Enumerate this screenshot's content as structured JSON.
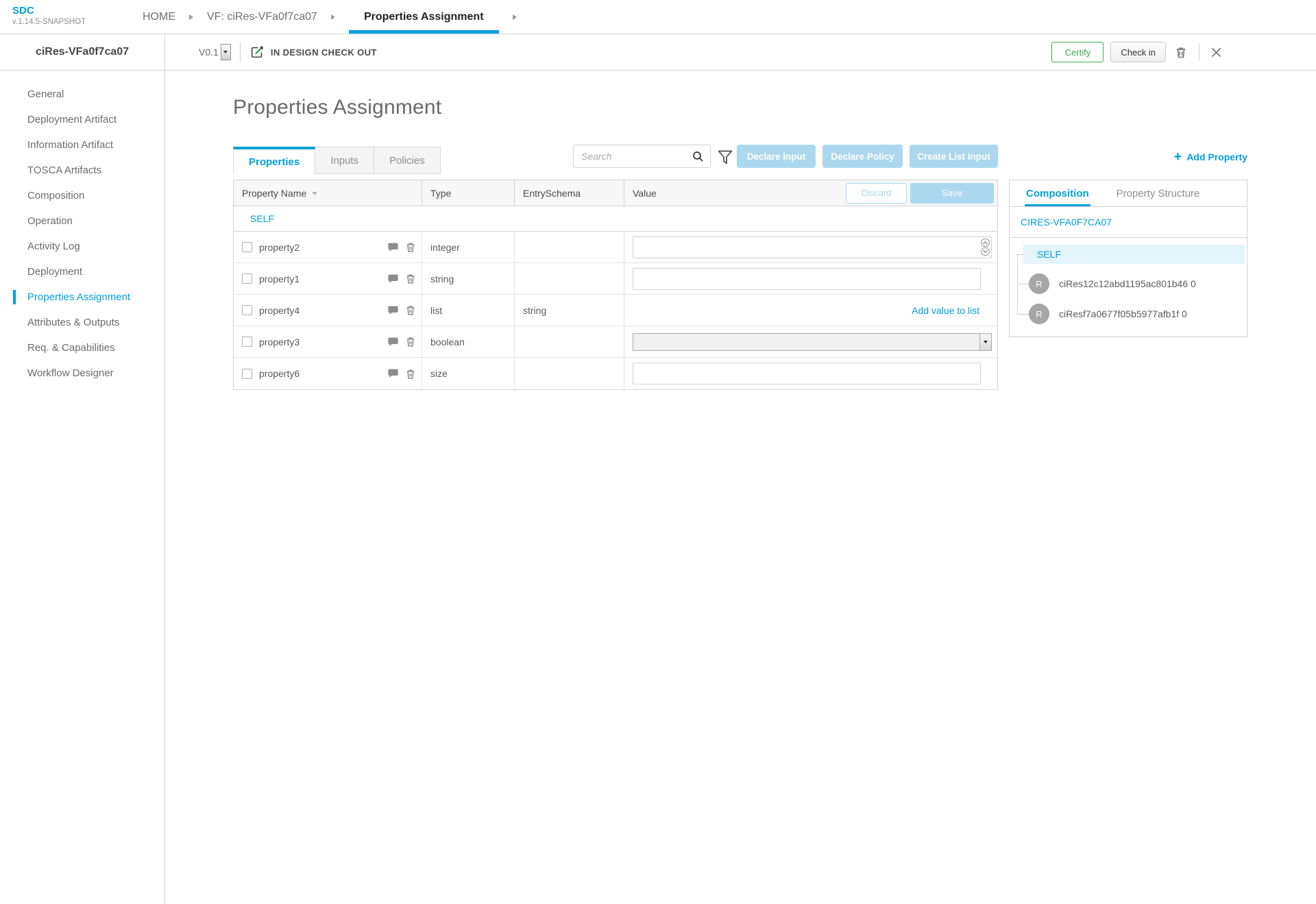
{
  "app": {
    "logo_title": "SDC",
    "logo_version": "v.1.14.5-SNAPSHOT"
  },
  "breadcrumbs": [
    {
      "label": "HOME"
    },
    {
      "label": "VF: ciRes-VFa0f7ca07"
    },
    {
      "label": "Properties Assignment",
      "active": true
    }
  ],
  "toolbar": {
    "entity_name": "ciRes-VFa0f7ca07",
    "version": "V0.1",
    "status": "IN DESIGN CHECK OUT",
    "certify_label": "Certify",
    "checkin_label": "Check in"
  },
  "sidebar": {
    "items": [
      {
        "label": "General"
      },
      {
        "label": "Deployment Artifact"
      },
      {
        "label": "Information Artifact"
      },
      {
        "label": "TOSCA Artifacts"
      },
      {
        "label": "Composition"
      },
      {
        "label": "Operation"
      },
      {
        "label": "Activity Log"
      },
      {
        "label": "Deployment"
      },
      {
        "label": "Properties Assignment",
        "active": true
      },
      {
        "label": "Attributes & Outputs"
      },
      {
        "label": "Req. & Capabilities"
      },
      {
        "label": "Workflow Designer"
      }
    ]
  },
  "main": {
    "page_title": "Properties Assignment",
    "tabs": [
      {
        "label": "Properties",
        "active": true
      },
      {
        "label": "Inputs"
      },
      {
        "label": "Policies"
      }
    ],
    "search_placeholder": "Search",
    "actions": [
      {
        "label": "Declare Input"
      },
      {
        "label": "Declare Policy"
      },
      {
        "label": "Create List Input"
      }
    ],
    "add_property_label": "Add Property"
  },
  "table": {
    "columns": [
      "Property Name",
      "Type",
      "EntrySchema",
      "Value"
    ],
    "discard_label": "Discard",
    "save_label": "Save",
    "group_label": "SELF",
    "rows": [
      {
        "name": "property2",
        "type": "integer",
        "entry_schema": "",
        "value_kind": "number",
        "value": ""
      },
      {
        "name": "property1",
        "type": "string",
        "entry_schema": "",
        "value_kind": "text",
        "value": ""
      },
      {
        "name": "property4",
        "type": "list",
        "entry_schema": "string",
        "value_kind": "list",
        "link_label": "Add value to list"
      },
      {
        "name": "property3",
        "type": "boolean",
        "entry_schema": "",
        "value_kind": "select",
        "value": ""
      },
      {
        "name": "property6",
        "type": "size",
        "entry_schema": "",
        "value_kind": "text",
        "value": ""
      }
    ]
  },
  "right_panel": {
    "tabs": [
      {
        "label": "Composition",
        "active": true
      },
      {
        "label": "Property Structure"
      }
    ],
    "root_label": "CIRES-VFA0F7CA07",
    "self_label": "SELF",
    "nodes": [
      {
        "badge": "R",
        "label": "ciRes12c12abd1195ac801b46 0"
      },
      {
        "badge": "R",
        "label": "ciResf7a0677f05b5977afb1f 0"
      }
    ]
  },
  "colors": {
    "accent": "#009fdb",
    "light_blue": "#abd8ee",
    "green": "#42a948"
  }
}
